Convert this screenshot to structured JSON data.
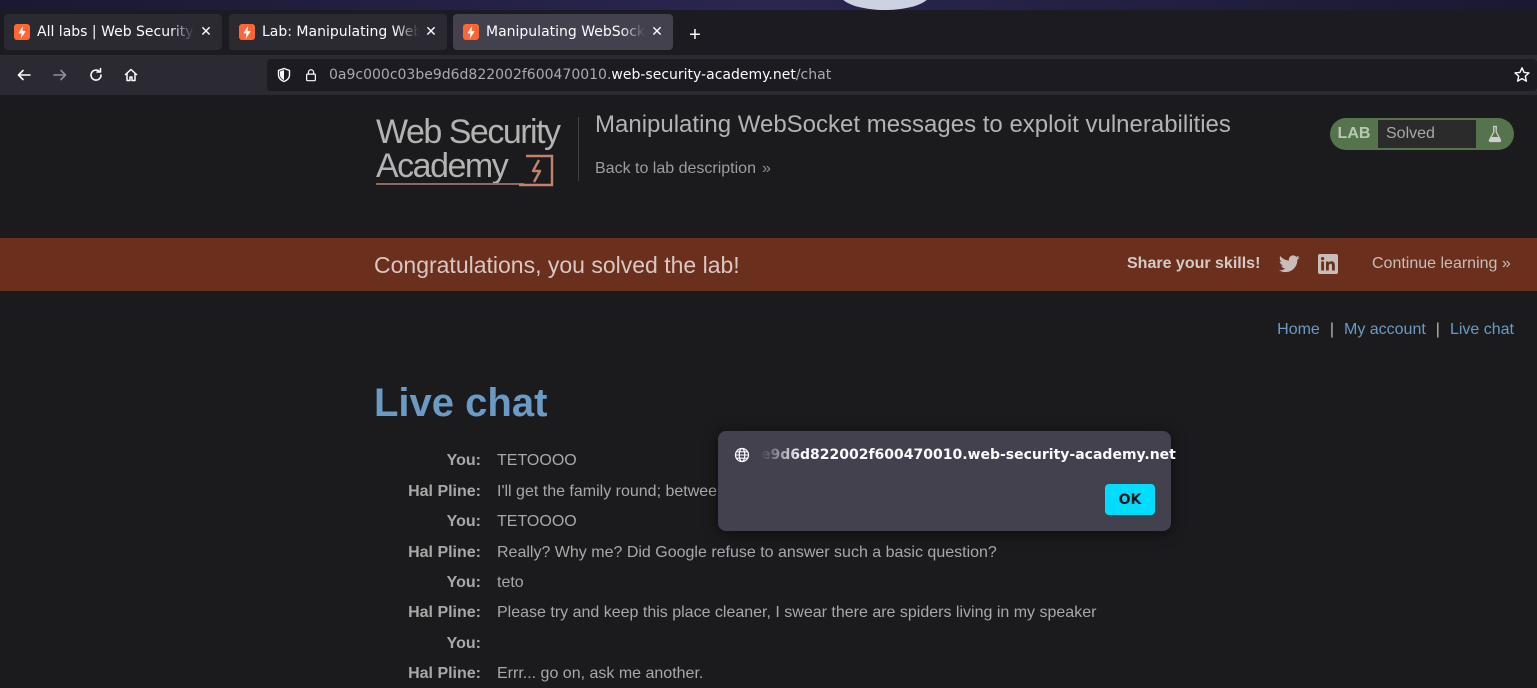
{
  "browser": {
    "tabs": [
      {
        "title": "All labs | Web Security Academy",
        "active": false
      },
      {
        "title": "Lab: Manipulating WebSocket messages to exploit vulnerabilities",
        "active": false
      },
      {
        "title": "Manipulating WebSocket messages to exploit vulnerabilities",
        "active": true
      }
    ],
    "new_tab_label": "+",
    "close_glyph": "✕",
    "url": {
      "prefix": "0a9c000c03be9d6d822002f600470010.",
      "domain": "web-security-academy.net",
      "path": "/chat"
    }
  },
  "header": {
    "logo_text": [
      "Web Security",
      "Academy"
    ],
    "lab_title": "Manipulating WebSocket messages to exploit vulnerabilities",
    "back_link": "Back to lab description",
    "back_chevron": "»",
    "status_label": "LAB",
    "status_value": "Solved"
  },
  "banner": {
    "message": "Congratulations, you solved the lab!",
    "share": "Share your skills!",
    "continue": "Continue learning »"
  },
  "nav": {
    "home": "Home",
    "account": "My account",
    "chat": "Live chat",
    "separator": "|"
  },
  "chat": {
    "heading": "Live chat",
    "messages": [
      {
        "who": "You:",
        "text": "TETOOOO"
      },
      {
        "who": "Hal Pline:",
        "text": "I'll get the family round; betwee"
      },
      {
        "who": "You:",
        "text": "TETOOOO"
      },
      {
        "who": "Hal Pline:",
        "text": "Really? Why me? Did Google refuse to answer such a basic question?"
      },
      {
        "who": "You:",
        "text": "teto"
      },
      {
        "who": "Hal Pline:",
        "text": "Please try and keep this place cleaner, I swear there are spiders living in my speaker"
      },
      {
        "who": "You:",
        "text": ""
      },
      {
        "who": "Hal Pline:",
        "text": "Errr... go on, ask me another."
      }
    ]
  },
  "dialog": {
    "origin": "e9d6d822002f600470010.web-security-academy.net",
    "ok_label": "OK"
  },
  "colors": {
    "banner": "#6b2f1e",
    "link": "#6b9ac4",
    "lab_badge": "#55734d",
    "ok_button": "#00ddff"
  }
}
